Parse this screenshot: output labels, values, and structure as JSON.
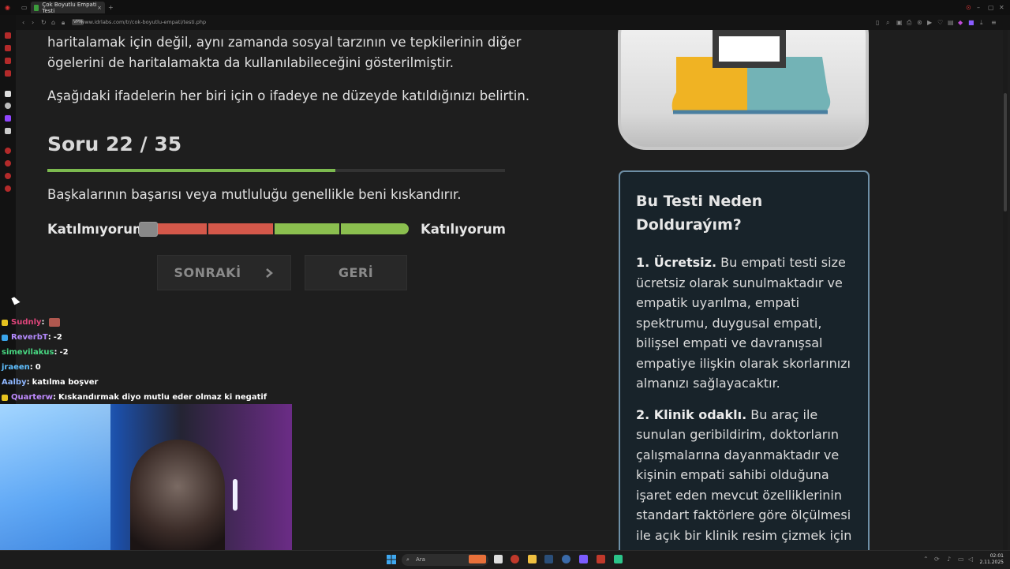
{
  "browser": {
    "tab_title": "Çok Boyutlu Empati Testi",
    "vpn_label": "VPN",
    "url": "www.idrlabs.com/tr/cok-boyutlu-empati/testi.php"
  },
  "page": {
    "intro_line_1": "haritalamak için değil, aynı zamanda sosyal tarzının ve tepkilerinin diğer",
    "intro_line_2": "ögelerini de haritalamakta da kullanılabileceğini gösterilmiştir.",
    "instruction": "Aşağıdaki ifadelerin her biri için o ifadeye ne düzeyde katıldığınızı belirtin.",
    "question_counter": "Soru 22 / 35",
    "progress_fraction": 0.63,
    "question_text": "Başkalarının başarısı veya mutluluğu genellikle beni kıskandırır.",
    "scale_left_label": "Katılmıyorum",
    "scale_right_label": "Katılıyorum",
    "next_button": "SONRAKİ",
    "next_icon": "chevron-right-icon",
    "back_button": "GERİ",
    "scale_colors": [
      "#d4584a",
      "#d4584a",
      "#8bbf4f",
      "#8bbf4f"
    ]
  },
  "side_card": {
    "title_line_1": "Bu Testi Neden",
    "title_line_2": "Dolduraýım?",
    "item1_bold": "1. Ücretsiz.",
    "item1_l1": " Bu empati testi size",
    "item1_l2": "ücretsiz olarak sunulmaktadır ve",
    "item1_l3": "empatik uyarılma, empati",
    "item1_l4": "spektrumu, duygusal empati,",
    "item1_l5": "bilişsel empati ve davranışsal",
    "item1_l6": "empatiye ilişkin olarak skorlarınızı",
    "item1_l7": "almanızı sağlayacaktır.",
    "item2_bold": "2. Klinik odaklı.",
    "item2_l1": " Bu araç ile",
    "item2_l2": "sunulan geribildirim, doktorların",
    "item2_l3": "çalışmalarına dayanmaktadır ve",
    "item2_l4": "kişinin empati sahibi olduğuna",
    "item2_l5": "işaret eden mevcut özelliklerinin",
    "item2_l6": "standart faktörlere göre ölçülmesi",
    "item2_l7": "ile açık bir klinik resim çizmek için"
  },
  "chat": [
    {
      "user": "Sudnly",
      "sep": " :",
      "msg": "",
      "color": "#e0457b",
      "badge": "#e6c21f"
    },
    {
      "user": "ReverbT",
      "sep": " :",
      "msg": "-2",
      "color": "#b58bff",
      "badge": "#3aa3e8"
    },
    {
      "user": "simevilakus",
      "sep": " :",
      "msg": "-2",
      "color": "#48d882",
      "badge": ""
    },
    {
      "user": "jraeen",
      "sep": " :",
      "msg": "0",
      "color": "#5fbfff",
      "badge": ""
    },
    {
      "user": "Aalby",
      "sep": " :",
      "msg": "katılma boşver",
      "color": "#8fb7ff",
      "badge": ""
    },
    {
      "user": "Quarterw",
      "sep": " :",
      "msg": "Kıskandırmak diyo mutlu eder olmaz ki negatif",
      "color": "#c08bff",
      "badge": "#e6c21f"
    }
  ],
  "taskbar": {
    "search_placeholder": "Ara",
    "time": "02:01",
    "date": "2.11.2025"
  }
}
